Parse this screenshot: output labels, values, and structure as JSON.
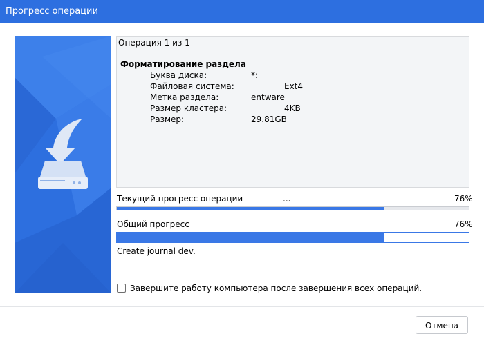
{
  "window": {
    "title": "Прогресс операции"
  },
  "log": {
    "header": "Операция 1 из 1",
    "operation_title": "Форматирование раздела",
    "rows": [
      {
        "key": "Буква диска:",
        "value": "*:"
      },
      {
        "key": "Файловая система:",
        "value": "Ext4"
      },
      {
        "key": "Метка раздела:",
        "value": "entware"
      },
      {
        "key": "Размер кластера:",
        "value": "4KB"
      },
      {
        "key": "Размер:",
        "value": "29.81GB"
      }
    ]
  },
  "current_progress": {
    "label": "Текущий прогресс операции",
    "status": "...",
    "percent_text": "76%",
    "fraction": 0.76
  },
  "total_progress": {
    "label": "Общий прогресс",
    "percent_text": "76%",
    "fraction": 0.76,
    "step_text": "Create journal dev."
  },
  "shutdown_option": {
    "label": "Завершите работу компьютера после завершения всех операций.",
    "checked": false
  },
  "buttons": {
    "cancel_label": "Отмена"
  },
  "colors": {
    "accent": "#2d6fe0",
    "panel": "#3275e4"
  },
  "icons": {
    "illustration": "disk-download-icon"
  }
}
